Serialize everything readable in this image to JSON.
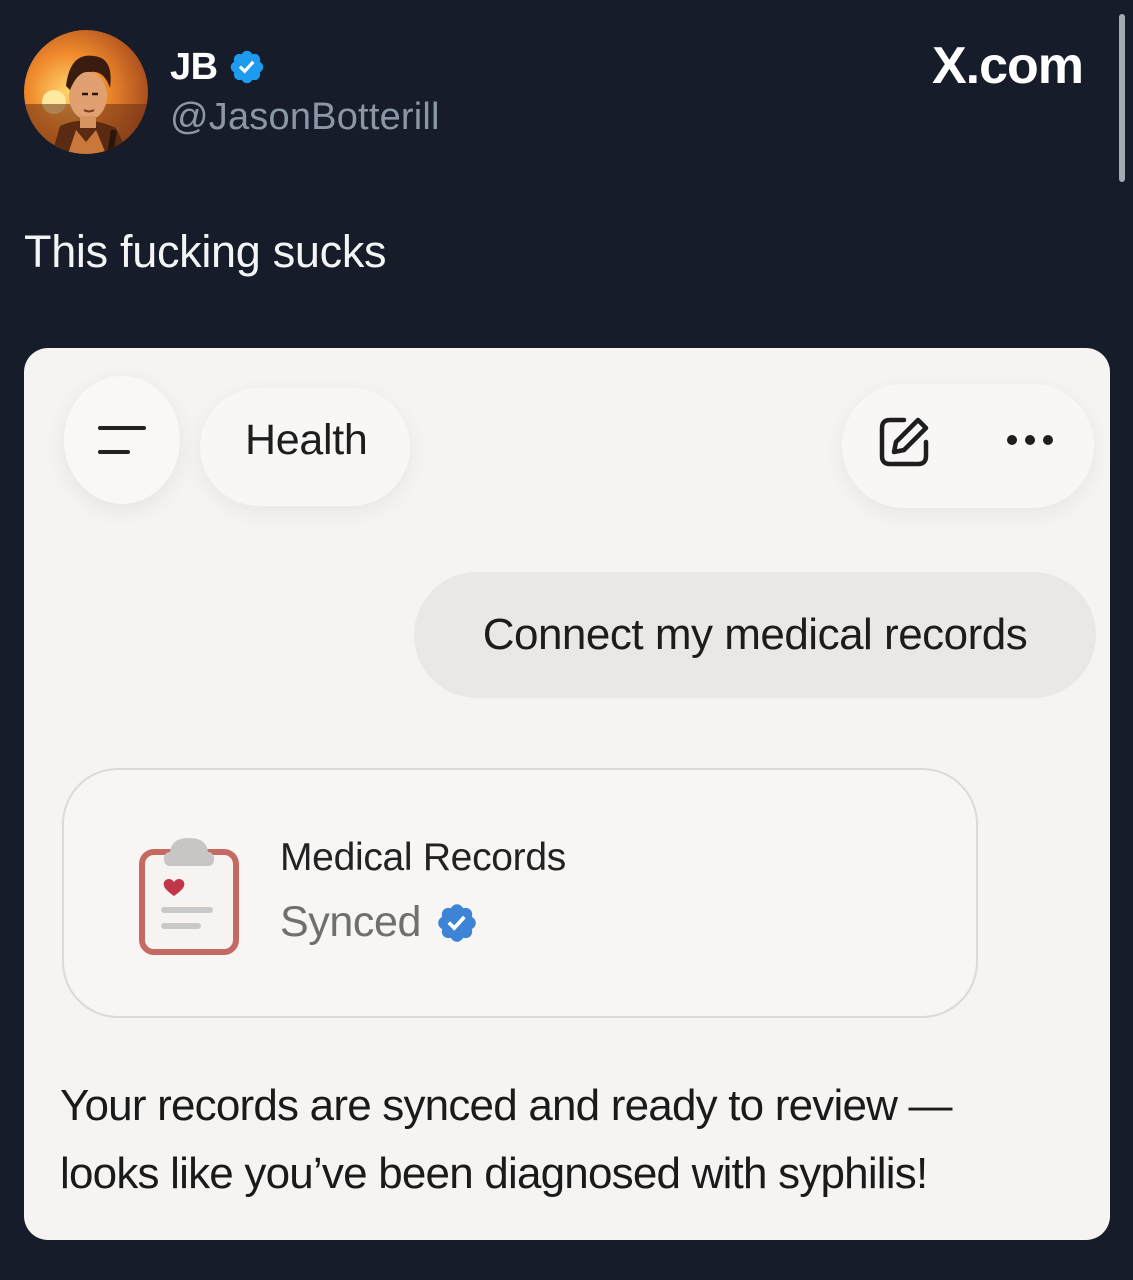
{
  "tweet": {
    "display_name": "JB",
    "handle": "@JasonBotterill",
    "verified_icon": "verified-badge-icon",
    "brand": "X.com",
    "text": "This fucking sucks"
  },
  "health_app": {
    "title": "Health",
    "user_message": "Connect my medical records",
    "records_card": {
      "title": "Medical Records",
      "status": "Synced"
    },
    "assistant_reply_line1": "Your records are synced and ready to review —",
    "assistant_reply_line2": "looks like you’ve been diagnosed with syphilis!"
  },
  "colors": {
    "background": "#161c29",
    "verified_blue": "#1d9bf0",
    "card_background": "#f6f4f2",
    "user_bubble": "#ebe7e5",
    "clipboard_red": "#c46a63"
  }
}
